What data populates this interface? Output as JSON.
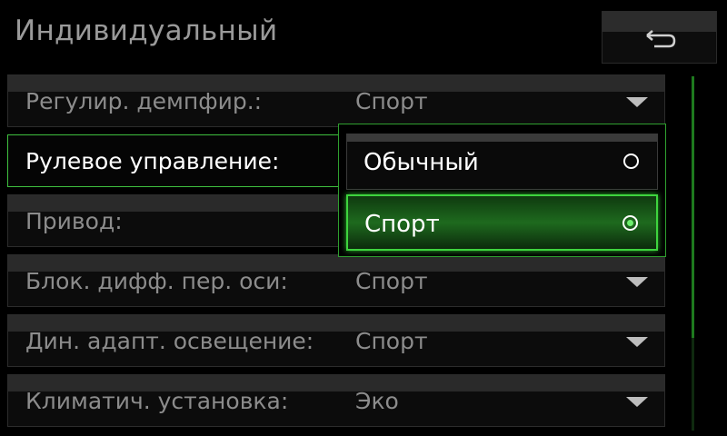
{
  "header": {
    "title": "Индивидуальный",
    "back_icon": "return-arrow-icon"
  },
  "rows": [
    {
      "label": "Регулир. демпфир.:",
      "value": "Спорт"
    },
    {
      "label": "Рулевое управление:",
      "value": ""
    },
    {
      "label": "Привод:",
      "value": ""
    },
    {
      "label": "Блок. дифф. пер. оси:",
      "value": "Спорт"
    },
    {
      "label": "Дин. адапт. освещение:",
      "value": "Спорт"
    },
    {
      "label": "Климатич. установка:",
      "value": "Эко"
    }
  ],
  "popup": {
    "options": [
      {
        "label": "Обычный",
        "selected": false
      },
      {
        "label": "Спорт",
        "selected": true
      }
    ]
  },
  "colors": {
    "accent": "#3ed43e",
    "background": "#000000",
    "text_dim": "#8c8c8c"
  }
}
